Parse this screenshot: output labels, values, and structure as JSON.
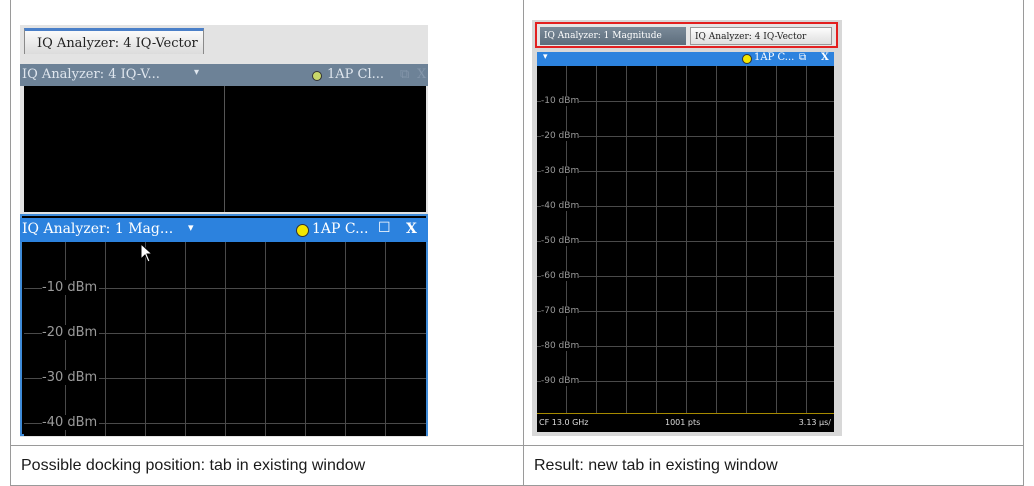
{
  "captions": {
    "left": "Possible docking position: tab in existing window",
    "right": "Result: new tab in existing window"
  },
  "left_panel": {
    "tab_label": "IQ Analyzer: 4 IQ-Vector",
    "window_top": {
      "title": "IQ Analyzer: 4 IQ-V...",
      "title_dropdown": "▾",
      "status": "1AP Cl...",
      "undock_icon": "⧉",
      "close_icon": "X"
    },
    "window_bottom": {
      "title": "IQ Analyzer: 1 Mag...",
      "title_dropdown": "▾",
      "status": "1AP C...",
      "maximize_icon": "☐",
      "close_icon": "X",
      "y_labels": [
        "-10 dBm",
        "-20 dBm",
        "-30 dBm",
        "-40 dBm"
      ]
    },
    "cursor": "arrow-cursor"
  },
  "right_panel": {
    "tabs": [
      "IQ Analyzer: 1 Magnitude",
      "IQ Analyzer: 4 IQ-Vector"
    ],
    "window": {
      "title_dropdown": "▾",
      "status": "1AP C...",
      "undock_icon": "⧉",
      "close_icon": "X",
      "y_labels": [
        "-10 dBm",
        "-20 dBm",
        "-30 dBm",
        "-40 dBm",
        "-50 dBm",
        "-60 dBm",
        "-70 dBm",
        "-80 dBm",
        "-90 dBm"
      ],
      "footer": {
        "center_freq": "CF 13.0 GHz",
        "points": "1001 pts",
        "time_per_div": "3.13 µs/"
      }
    }
  },
  "colors": {
    "active_titlebar": "#2c82de",
    "inactive_titlebar": "#6d8297",
    "highlight_border": "#e32020",
    "status_dot": "#f3e600"
  }
}
